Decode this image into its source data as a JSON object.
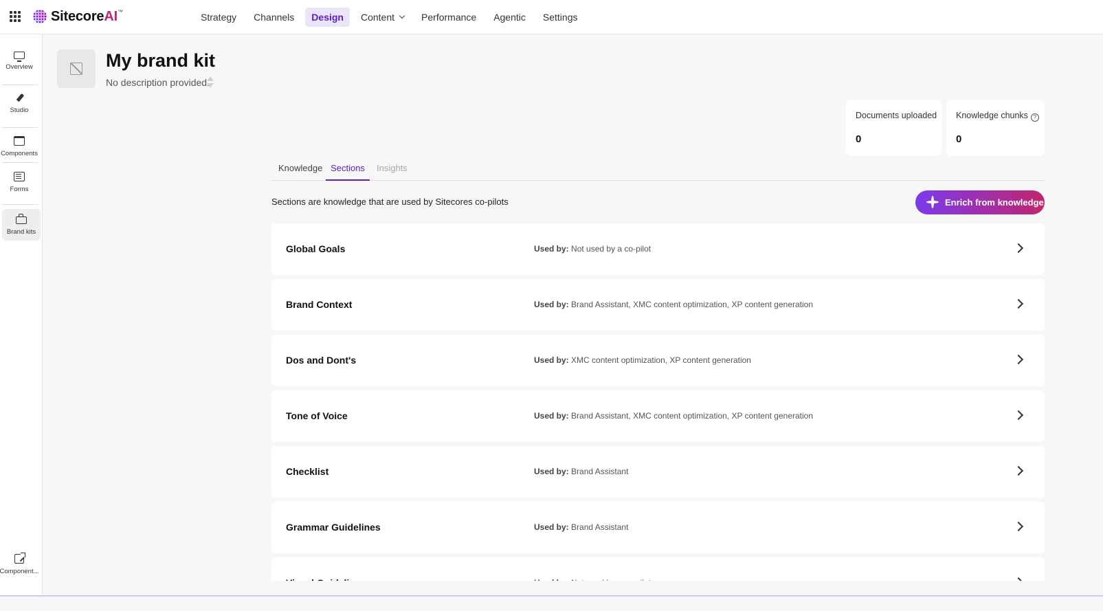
{
  "app": {
    "brand_name": "Sitecore",
    "brand_suffix": "AI",
    "brand_mark": "™"
  },
  "nav": [
    {
      "label": "Strategy",
      "active": false,
      "has_menu": false
    },
    {
      "label": "Channels",
      "active": false,
      "has_menu": false
    },
    {
      "label": "Design",
      "active": true,
      "has_menu": false
    },
    {
      "label": "Content",
      "active": false,
      "has_menu": true
    },
    {
      "label": "Performance",
      "active": false,
      "has_menu": false
    },
    {
      "label": "Agentic",
      "active": false,
      "has_menu": false
    },
    {
      "label": "Settings",
      "active": false,
      "has_menu": false
    }
  ],
  "rail": [
    {
      "label": "Overview",
      "icon": "monitor-icon"
    },
    {
      "label": "Studio",
      "icon": "pen-icon"
    },
    {
      "label": "Components",
      "icon": "calendar-icon"
    },
    {
      "label": "Forms",
      "icon": "form-icon"
    },
    {
      "label": "Brand kits",
      "icon": "briefcase-icon",
      "active": true
    }
  ],
  "rail_bottom": {
    "label": "Component...",
    "icon": "external-link-icon"
  },
  "kit": {
    "title": "My brand kit",
    "description": "No description provided."
  },
  "stats": [
    {
      "label": "Documents uploaded",
      "value": "0",
      "help": false
    },
    {
      "label": "Knowledge chunks",
      "value": "0",
      "help": true
    }
  ],
  "tabs": [
    {
      "label": "Knowledge",
      "state": "normal"
    },
    {
      "label": "Sections",
      "state": "active"
    },
    {
      "label": "Insights",
      "state": "disabled"
    }
  ],
  "sections_description": "Sections are knowledge that are used by Sitecores co-pilots",
  "enrich_button": "Enrich from knowledge",
  "used_by_label": "Used by:",
  "sections": [
    {
      "title": "Global Goals",
      "used_by": "Not used by a co-pilot"
    },
    {
      "title": "Brand Context",
      "used_by": "Brand Assistant, XMC content optimization, XP content generation"
    },
    {
      "title": "Dos and Dont's",
      "used_by": "XMC content optimization, XP content generation"
    },
    {
      "title": "Tone of Voice",
      "used_by": "Brand Assistant, XMC content optimization, XP content generation"
    },
    {
      "title": "Checklist",
      "used_by": "Brand Assistant"
    },
    {
      "title": "Grammar Guidelines",
      "used_by": "Brand Assistant"
    },
    {
      "title": "Visual Guidelines",
      "used_by": "Not used by a co-pilot"
    }
  ],
  "colors": {
    "accent": "#5b21b6",
    "active_nav_bg": "#ebe4fb",
    "gradient_start": "#7c3aed",
    "gradient_end": "#c0266d"
  }
}
